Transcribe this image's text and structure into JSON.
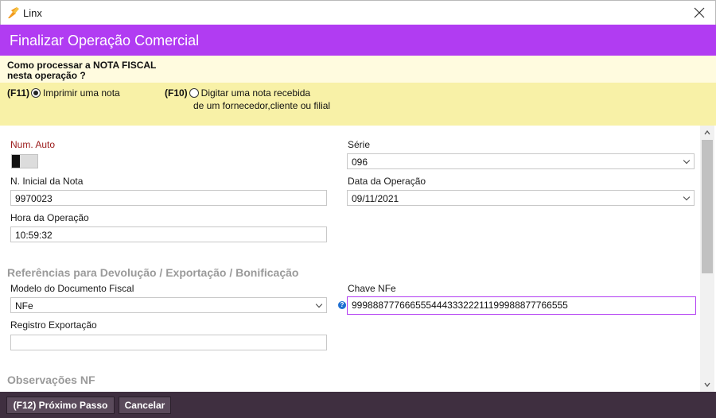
{
  "window": {
    "app_title": "Linx",
    "logo_icon": "linx-logo-icon",
    "close_icon": "close-icon"
  },
  "header": {
    "title": "Finalizar Operação Comercial"
  },
  "question": {
    "line1": "Como processar a NOTA FISCAL",
    "line2": "nesta operação ?"
  },
  "options": {
    "print": {
      "key": "(F11)",
      "label": "Imprimir uma nota",
      "checked": true
    },
    "type": {
      "key": "(F10)",
      "label_line1": "Digitar uma nota recebida",
      "label_line2": "de um fornecedor,cliente ou filial",
      "checked": false
    }
  },
  "form": {
    "num_auto": {
      "label": "Num. Auto",
      "toggle_on": false
    },
    "serie": {
      "label": "Série",
      "value": "096"
    },
    "n_inicial": {
      "label": "N. Inicial da Nota",
      "value": "9970023"
    },
    "data_operacao": {
      "label": "Data da Operação",
      "value": "09/11/2021"
    },
    "hora_operacao": {
      "label": "Hora da Operação",
      "value": "10:59:32"
    },
    "section_refs": "Referências para Devolução / Exportação / Bonificação",
    "modelo": {
      "label": "Modelo do Documento Fiscal",
      "value": "NFe"
    },
    "chave_nfe": {
      "label": "Chave NFe",
      "value": "99988877766655544433322211199988877766555",
      "info_icon": "?"
    },
    "registro_exportacao": {
      "label": "Registro Exportação",
      "value": ""
    },
    "section_obs": "Observações NF"
  },
  "footer": {
    "next_label": "(F12) Próximo Passo",
    "cancel_label": "Cancelar"
  },
  "colors": {
    "header_bg": "#b13cf2",
    "question_bg": "#fffbdf",
    "options_bg": "#f8f1a7",
    "footer_bg": "#3f2f40",
    "label_red": "#9b1b1b"
  }
}
